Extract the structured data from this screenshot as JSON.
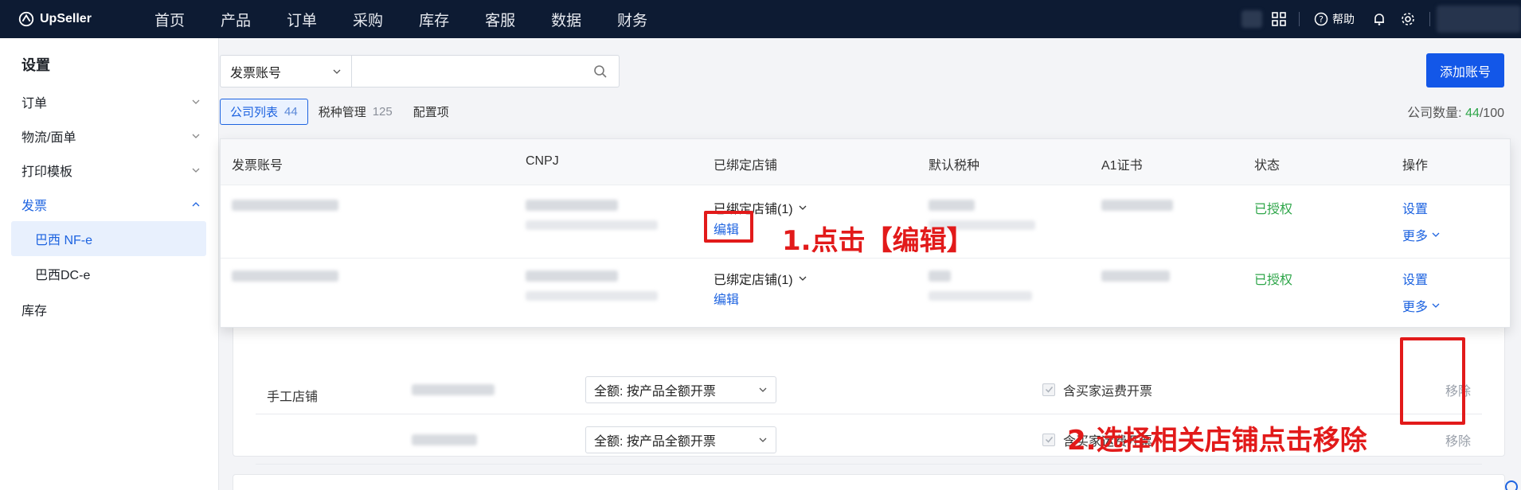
{
  "brand": {
    "name": "UpSeller"
  },
  "nav": {
    "items": [
      "首页",
      "产品",
      "订单",
      "采购",
      "库存",
      "客服",
      "数据",
      "财务"
    ]
  },
  "header": {
    "help_label": "帮助"
  },
  "sidebar": {
    "title": "设置",
    "items": [
      {
        "label": "订单"
      },
      {
        "label": "物流/面单"
      },
      {
        "label": "打印模板"
      },
      {
        "label": "发票"
      },
      {
        "label": "库存"
      }
    ],
    "subitems": [
      {
        "label": "巴西 NF-e"
      },
      {
        "label": "巴西DC-e"
      }
    ]
  },
  "search": {
    "select_label": "发票账号",
    "placeholder": ""
  },
  "toolbar": {
    "add_account_label": "添加账号"
  },
  "tabs": [
    {
      "label": "公司列表",
      "count": "44"
    },
    {
      "label": "税种管理",
      "count": "125"
    },
    {
      "label": "配置项",
      "count": ""
    }
  ],
  "company_count": {
    "label": "公司数量:",
    "current": "44",
    "total": "/100"
  },
  "table": {
    "headers": [
      "发票账号",
      "CNPJ",
      "已绑定店铺",
      "默认税种",
      "A1证书",
      "状态",
      "操作"
    ],
    "rows": [
      {
        "bound_stores": "已绑定店铺(1)",
        "edit_label": "编辑",
        "status": "已授权",
        "setting_label": "设置",
        "more_label": "更多"
      },
      {
        "bound_stores": "已绑定店铺(1)",
        "edit_label": "编辑",
        "status": "已授权",
        "setting_label": "设置",
        "more_label": "更多"
      }
    ]
  },
  "stores": {
    "type_label": "手工店铺",
    "rows": [
      {
        "invoice_option": "全额: 按产品全额开票",
        "shipping_label": "含买家运费开票",
        "remove_label": "移除"
      },
      {
        "invoice_option": "全额: 按产品全额开票",
        "shipping_label": "含买家运费开票",
        "remove_label": "移除"
      }
    ]
  },
  "annotations": {
    "step1": "1.点击【编辑】",
    "step2": "2.选择相关店铺点击移除"
  },
  "colors": {
    "accent": "#1357e8",
    "annotation": "#e21a1a",
    "status_ok": "#2fa64a",
    "topbar": "#0d1b33"
  }
}
